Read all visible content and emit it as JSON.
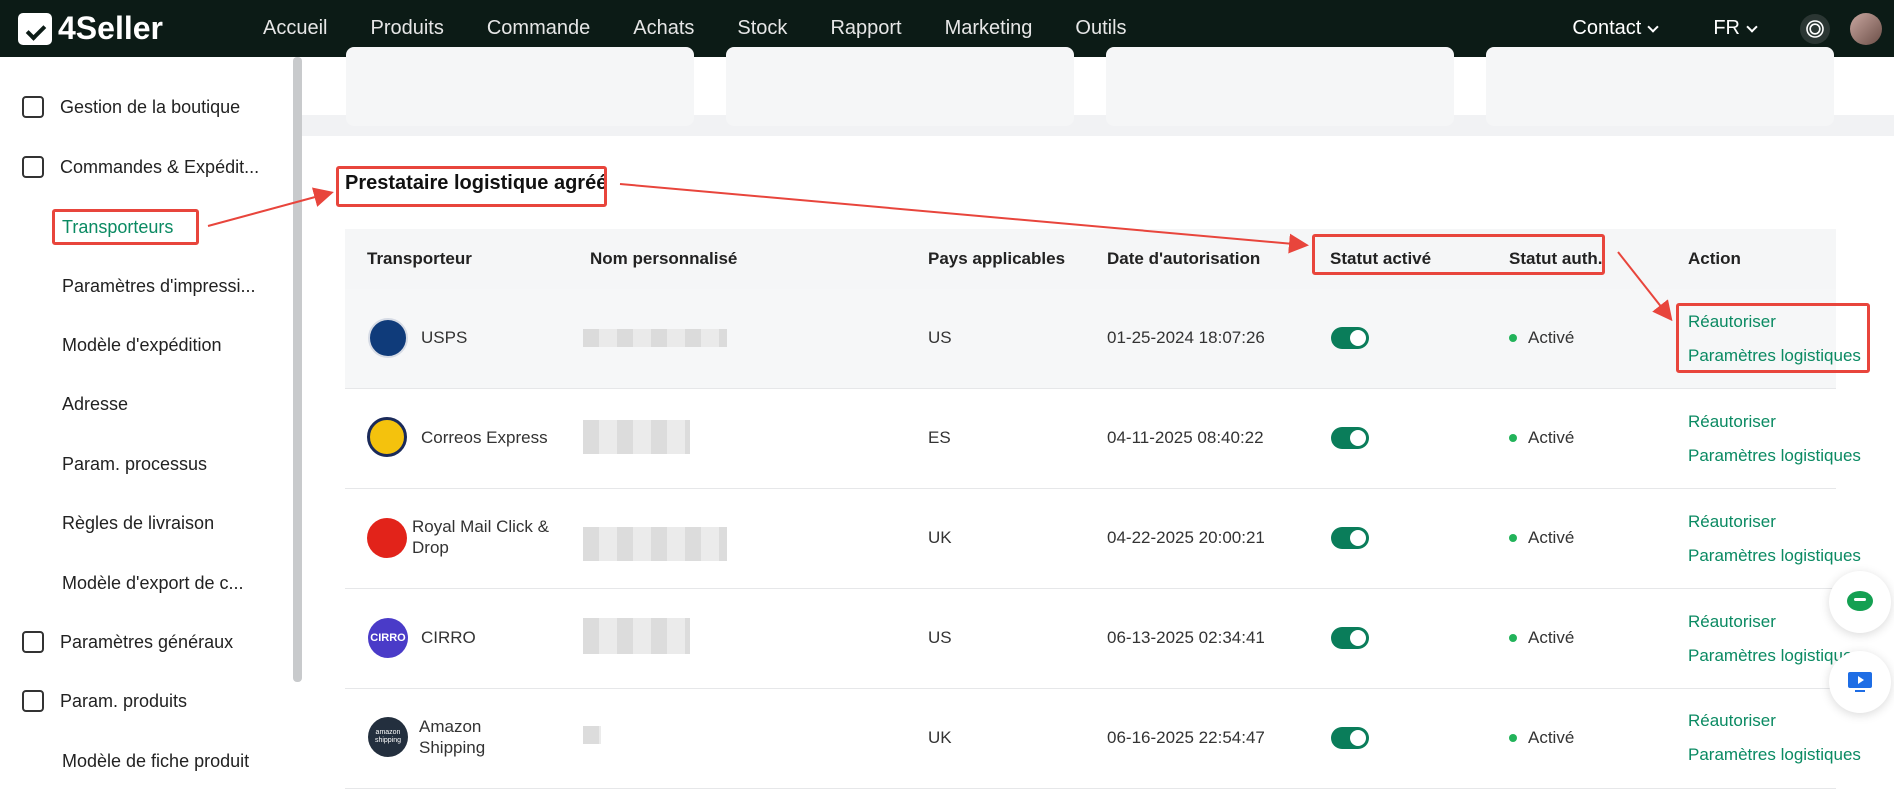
{
  "app": {
    "name": "4Seller"
  },
  "nav": [
    "Accueil",
    "Produits",
    "Commande",
    "Achats",
    "Stock",
    "Rapport",
    "Marketing",
    "Outils"
  ],
  "topright": {
    "contact": "Contact",
    "lang": "FR"
  },
  "sidebar": {
    "items": [
      {
        "label": "Gestion de la boutique",
        "type": "main",
        "icon": "store-icon"
      },
      {
        "label": "Commandes & Expédit...",
        "type": "main",
        "icon": "order-icon"
      },
      {
        "label": "Transporteurs",
        "type": "sub",
        "active": true
      },
      {
        "label": "Paramètres d'impressi...",
        "type": "sub"
      },
      {
        "label": "Modèle d'expédition",
        "type": "sub"
      },
      {
        "label": "Adresse",
        "type": "sub"
      },
      {
        "label": "Param. processus",
        "type": "sub"
      },
      {
        "label": "Règles de livraison",
        "type": "sub"
      },
      {
        "label": "Modèle d'export de c...",
        "type": "sub"
      },
      {
        "label": "Paramètres généraux",
        "type": "main",
        "icon": "settings-list-icon"
      },
      {
        "label": "Param. produits",
        "type": "main",
        "icon": "product-icon"
      },
      {
        "label": "Modèle de fiche produit",
        "type": "sub"
      }
    ]
  },
  "section": {
    "title": "Prestataire logistique agréé"
  },
  "table": {
    "headers": [
      "Transporteur",
      "Nom personnalisé",
      "Pays applicables",
      "Date d'autorisation",
      "Statut activé",
      "Statut auth.",
      "Action"
    ],
    "rows": [
      {
        "carrier": "USPS",
        "country": "US",
        "date": "01-25-2024 18:07:26",
        "status": "Activé",
        "action1": "Réautoriser",
        "action2": "Paramètres logistiques"
      },
      {
        "carrier": "Correos Express",
        "country": "ES",
        "date": "04-11-2025 08:40:22",
        "status": "Activé",
        "action1": "Réautoriser",
        "action2": "Paramètres logistiques"
      },
      {
        "carrier": "Royal Mail Click &",
        "carrier2": "Drop",
        "country": "UK",
        "date": "04-22-2025 20:00:21",
        "status": "Activé",
        "action1": "Réautoriser",
        "action2": "Paramètres logistiques"
      },
      {
        "carrier": "CIRRO",
        "country": "US",
        "date": "06-13-2025 02:34:41",
        "status": "Activé",
        "action1": "Réautoriser",
        "action2": "Paramètres logistique"
      },
      {
        "carrier": "Amazon",
        "carrier2": "Shipping",
        "country": "UK",
        "date": "06-16-2025 22:54:47",
        "status": "Activé",
        "action1": "Réautoriser",
        "action2": "Paramètres logistiques"
      }
    ]
  },
  "logos": {
    "cirro": "CIRRO",
    "amazon": "amazon shipping"
  },
  "colors": {
    "accent": "#0a8a62",
    "highlight": "#e8453c",
    "topbar": "#0c1b16"
  }
}
